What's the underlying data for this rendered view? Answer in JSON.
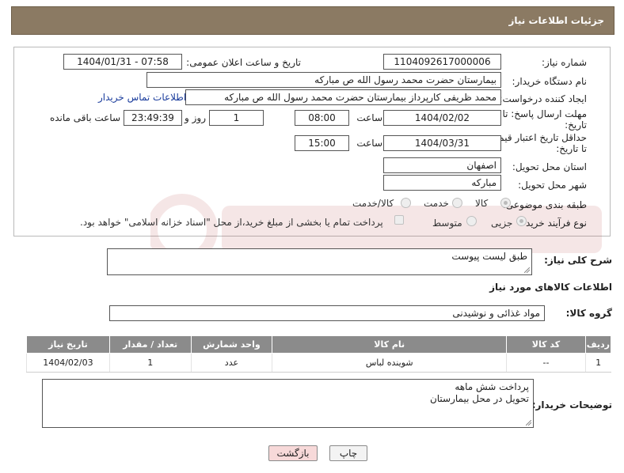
{
  "header": {
    "title": "جزئیات اطلاعات نیاز"
  },
  "form": {
    "need_number": {
      "label": "شماره نیاز:",
      "value": "1104092617000006"
    },
    "announce": {
      "label": "تاریخ و ساعت اعلان عمومی:",
      "value": "1404/01/31 - 07:58"
    },
    "buyer_org": {
      "label": "نام دستگاه خریدار:",
      "value": "بیمارستان حضرت محمد رسول الله  ص  مبارکه"
    },
    "creator": {
      "label": "ایجاد کننده درخواست:",
      "value": "محمد ظریفی کارپرداز بیمارستان حضرت محمد رسول الله  ص  مبارکه",
      "contact_link": "اطلاعات تماس خریدار"
    },
    "deadline": {
      "label_line1": "مهلت ارسال پاسخ: تا",
      "label_line2": "تاریخ:",
      "date": "1404/02/02",
      "time_label": "ساعت",
      "time": "08:00",
      "days": "1",
      "days_label": "روز و",
      "remaining": "23:49:39",
      "remaining_label": "ساعت باقی مانده"
    },
    "validity": {
      "label_line1": "حداقل تاریخ اعتبار قیمت:",
      "label_line2": "تا تاریخ:",
      "date": "1404/03/31",
      "time_label": "ساعت",
      "time": "15:00"
    },
    "province": {
      "label": "استان محل تحویل:",
      "value": "اصفهان"
    },
    "city": {
      "label": "شهر محل تحویل:",
      "value": "مبارکه"
    },
    "category": {
      "label": "طبقه بندی موضوعی:",
      "options": [
        "کالا",
        "خدمت",
        "کالا/خدمت"
      ],
      "selected": "کالا"
    },
    "process": {
      "label": "نوع فرآیند خرید :",
      "options": [
        "جزیی",
        "متوسط"
      ],
      "selected": "جزیی",
      "note": "پرداخت تمام یا بخشی از مبلغ خرید،از محل \"اسناد خزانه اسلامی\" خواهد بود."
    }
  },
  "description": {
    "label": "شرح کلی نیاز:",
    "value": "طبق لیست پیوست"
  },
  "goods_section": {
    "title": "اطلاعات کالاهای مورد نیاز"
  },
  "goods_group": {
    "label": "گروه کالا:",
    "value": "مواد غذائی و نوشیدنی"
  },
  "items_table": {
    "headers": [
      "ردیف",
      "کد کالا",
      "نام کالا",
      "واحد شمارش",
      "تعداد / مقدار",
      "تاریخ نیاز"
    ],
    "rows": [
      [
        "1",
        "--",
        "شوینده لباس",
        "عدد",
        "1",
        "1404/02/03"
      ]
    ]
  },
  "buyer_notes": {
    "label": "توضیحات خریدار:",
    "line1": "پرداخت شش ماهه",
    "line2": "تحویل در محل بیمارستان"
  },
  "buttons": {
    "print": "چاپ",
    "back": "بازگشت"
  },
  "colors": {
    "header_bg": "#8b7a63",
    "table_header_bg": "#8b8b8b",
    "link": "#1a3c9c",
    "back_button_bg": "#f7d9d9"
  }
}
